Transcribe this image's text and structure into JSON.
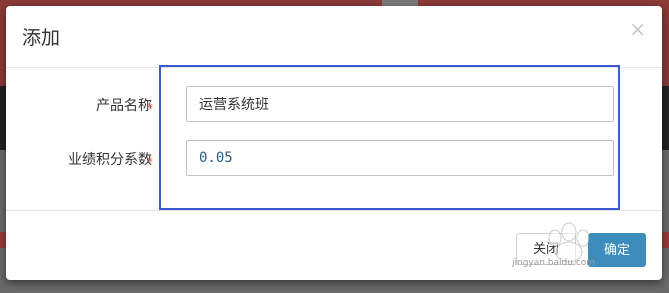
{
  "modal": {
    "title": "添加",
    "close_glyph": "×"
  },
  "form": {
    "fields": [
      {
        "label": "产品名称",
        "required_mark": "*",
        "value": "运营系统班"
      },
      {
        "label": "业绩积分系数",
        "required_mark": "*",
        "value": "0.05"
      }
    ]
  },
  "footer": {
    "close_label": "关闭",
    "confirm_label": "确定"
  },
  "watermark": {
    "text": "jingyan.baidu.com"
  },
  "colors": {
    "primary": "#3c8dbc",
    "required": "#d9534f",
    "highlight": "#3a5bd0",
    "backdrop_top": "#8c3a36"
  }
}
